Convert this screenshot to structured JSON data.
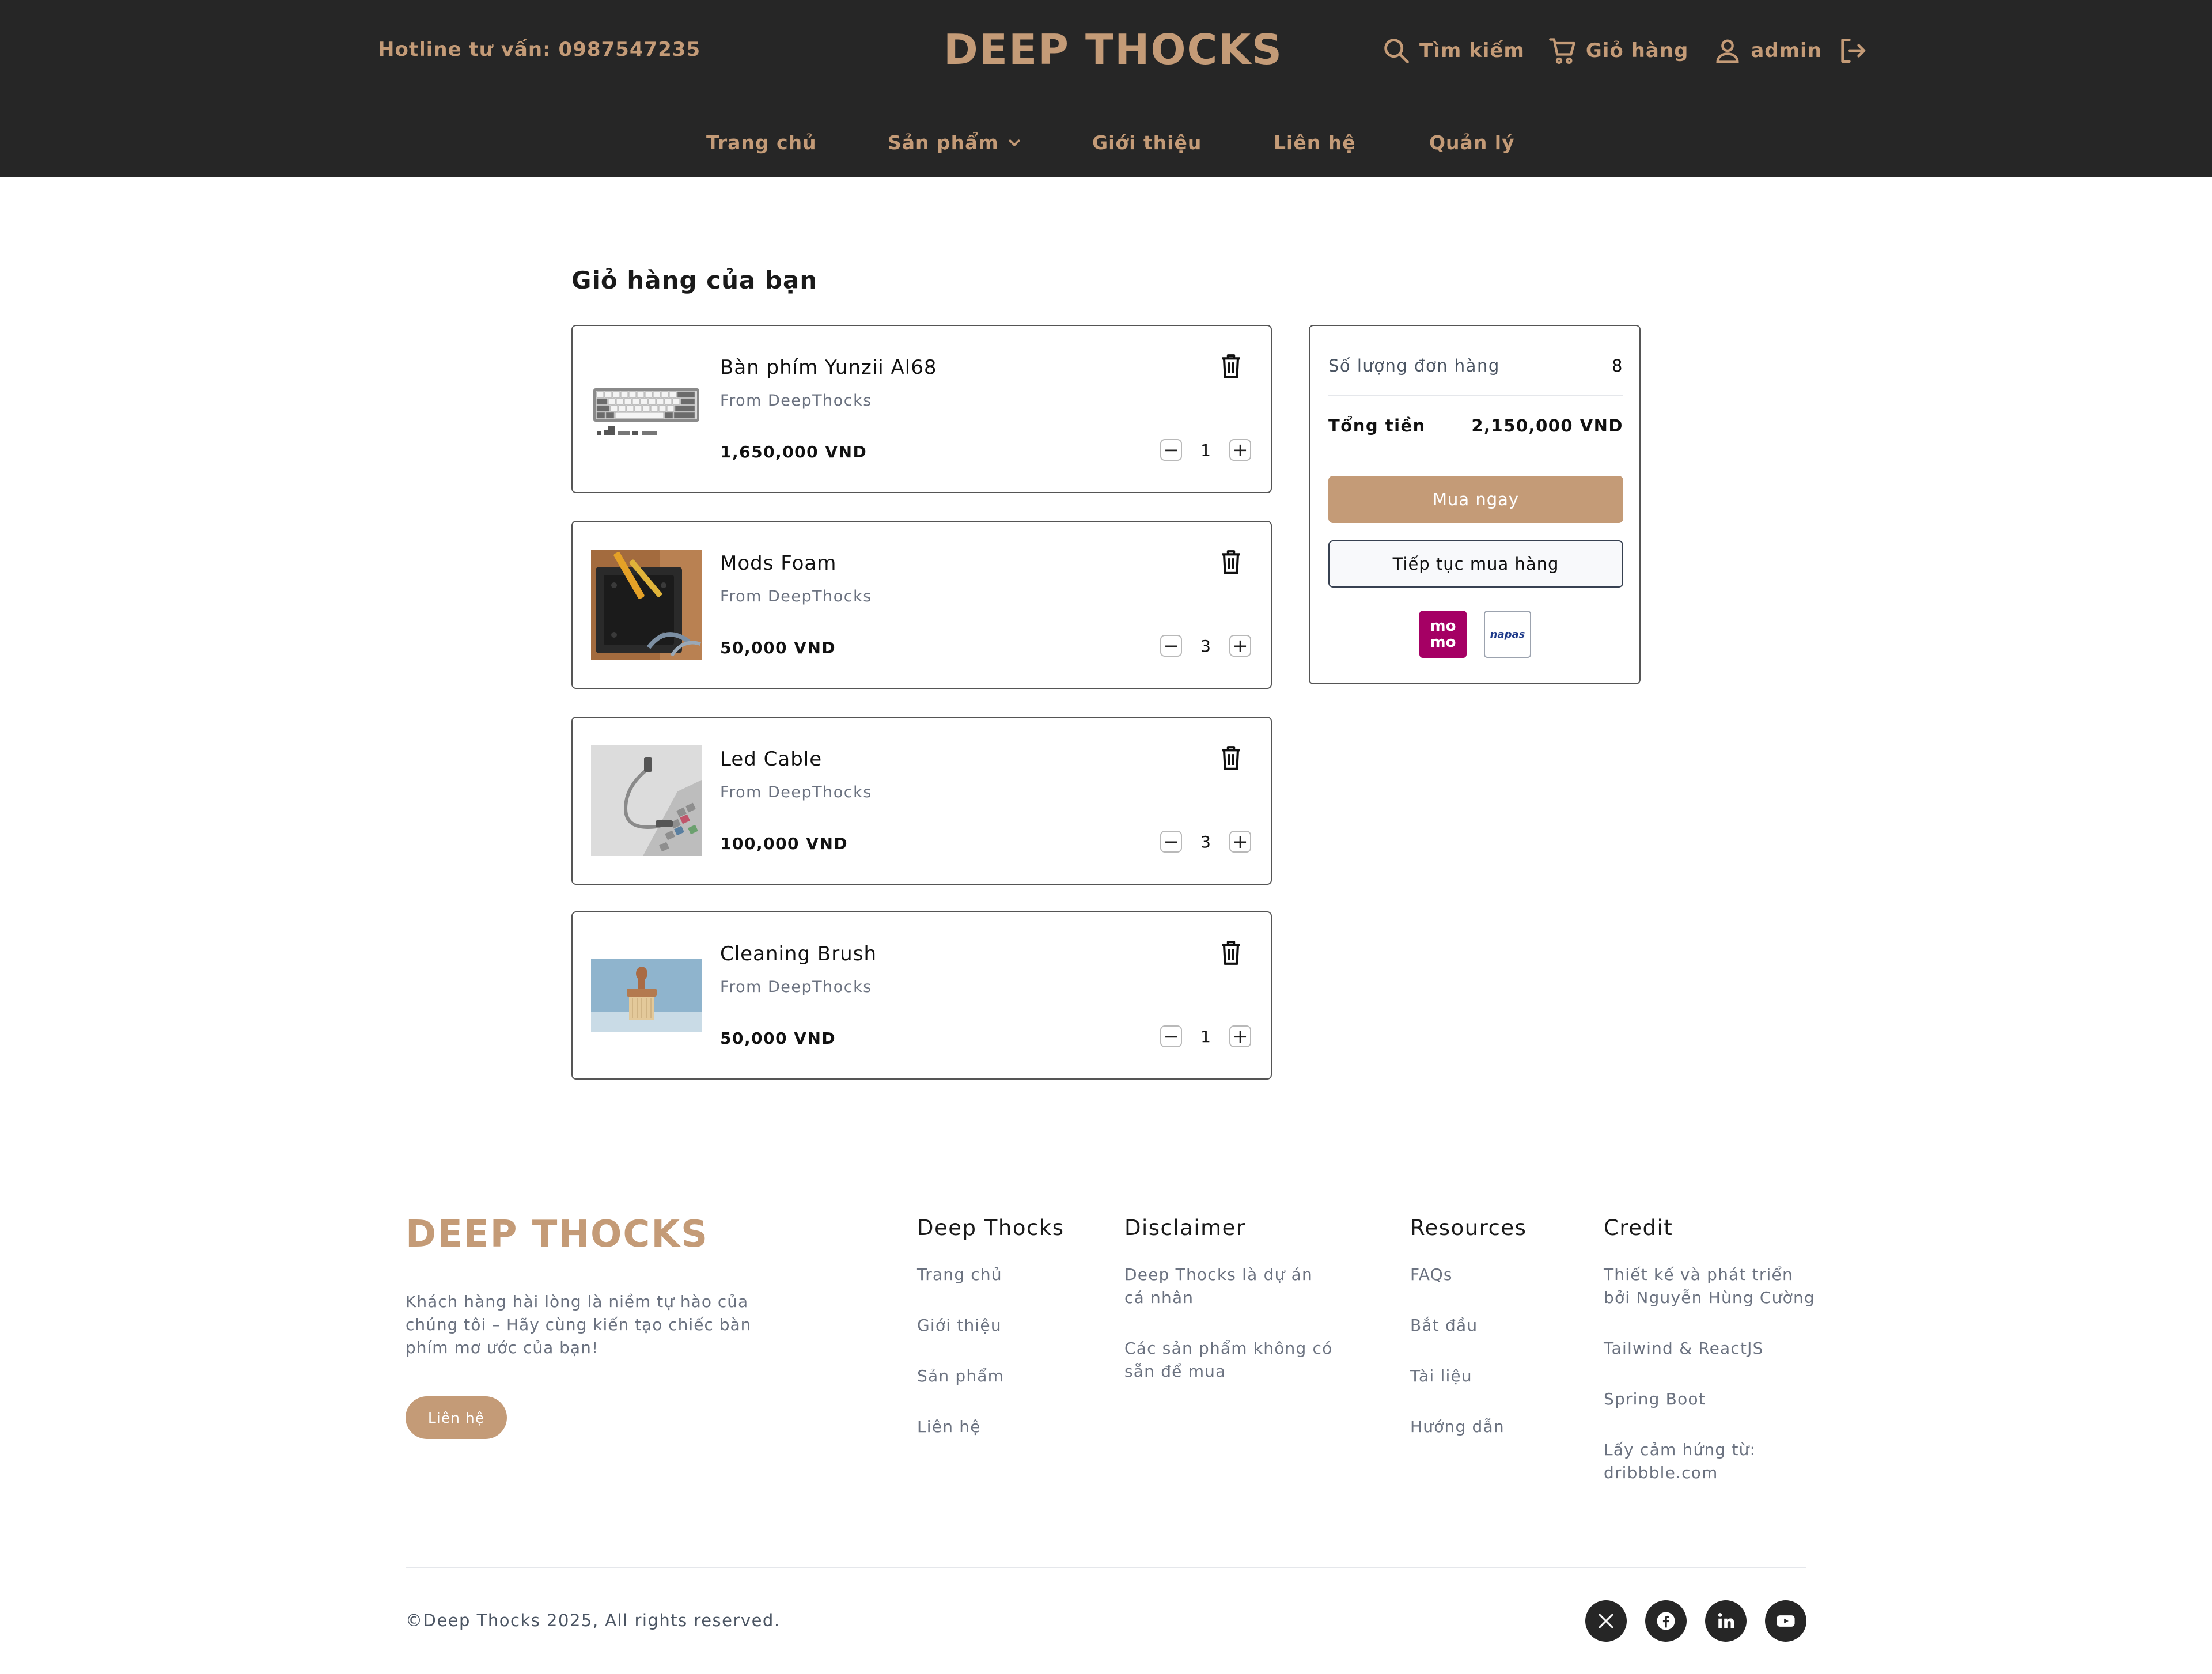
{
  "header": {
    "hotline_label": "Hotline tư vấn:",
    "hotline_number": "0987547235",
    "logo": "DEEP THOCKS",
    "search_label": "Tìm kiếm",
    "cart_label": "Giỏ hàng",
    "user_label": "admin",
    "accent_color": "#c49b77",
    "background_color": "#262626"
  },
  "nav": {
    "items": [
      "Trang chủ",
      "Sản phẩm",
      "Giới thiệu",
      "Liên hệ",
      "Quản lý"
    ]
  },
  "cart": {
    "title": "Giỏ hàng của bạn",
    "items": [
      {
        "name": "Bàn phím Yunzii Al68",
        "from": "From DeepThocks",
        "price": "1,650,000 VND",
        "qty": "1",
        "image": "keyboard"
      },
      {
        "name": "Mods Foam",
        "from": "From DeepThocks",
        "price": "50,000 VND",
        "qty": "3",
        "image": "foam"
      },
      {
        "name": "Led Cable",
        "from": "From DeepThocks",
        "price": "100,000 VND",
        "qty": "3",
        "image": "cable"
      },
      {
        "name": "Cleaning Brush",
        "from": "From DeepThocks",
        "price": "50,000 VND",
        "qty": "1",
        "image": "brush"
      }
    ]
  },
  "summary": {
    "count_label": "Số lượng đơn hàng",
    "count_value": "8",
    "total_label": "Tổng tiền",
    "total_value": "2,150,000 VND",
    "buy_label": "Mua ngay",
    "continue_label": "Tiếp tục mua hàng",
    "payment_momo_line1": "mo",
    "payment_momo_line2": "mo",
    "payment_napas": "napas"
  },
  "footer": {
    "logo": "DEEP THOCKS",
    "description": "Khách hàng hài lòng là niềm tự hào của chúng tôi – Hãy cùng kiến tạo chiếc bàn phím mơ ước của bạn!",
    "contact_button": "Liên hệ",
    "columns": [
      {
        "heading": "Deep Thocks",
        "links": [
          "Trang chủ",
          "Giới thiệu",
          "Sản phẩm",
          "Liên hệ"
        ]
      },
      {
        "heading": "Disclaimer",
        "links": [
          "Deep Thocks là dự án cá nhân",
          "Các sản phẩm không có sẵn để mua"
        ]
      },
      {
        "heading": "Resources",
        "links": [
          "FAQs",
          "Bắt đầu",
          "Tài liệu",
          "Hướng dẫn"
        ]
      },
      {
        "heading": "Credit",
        "links": [
          "Thiết kế và phát triển bởi Nguyễn Hùng Cường",
          "Tailwind & ReactJS",
          "Spring Boot",
          "Lấy cảm hứng từ: dribbble.com"
        ]
      }
    ],
    "copyright": "©Deep Thocks 2025, All rights reserved.",
    "social_icons": [
      "x-icon",
      "facebook-icon",
      "linkedin-icon",
      "youtube-icon"
    ]
  }
}
